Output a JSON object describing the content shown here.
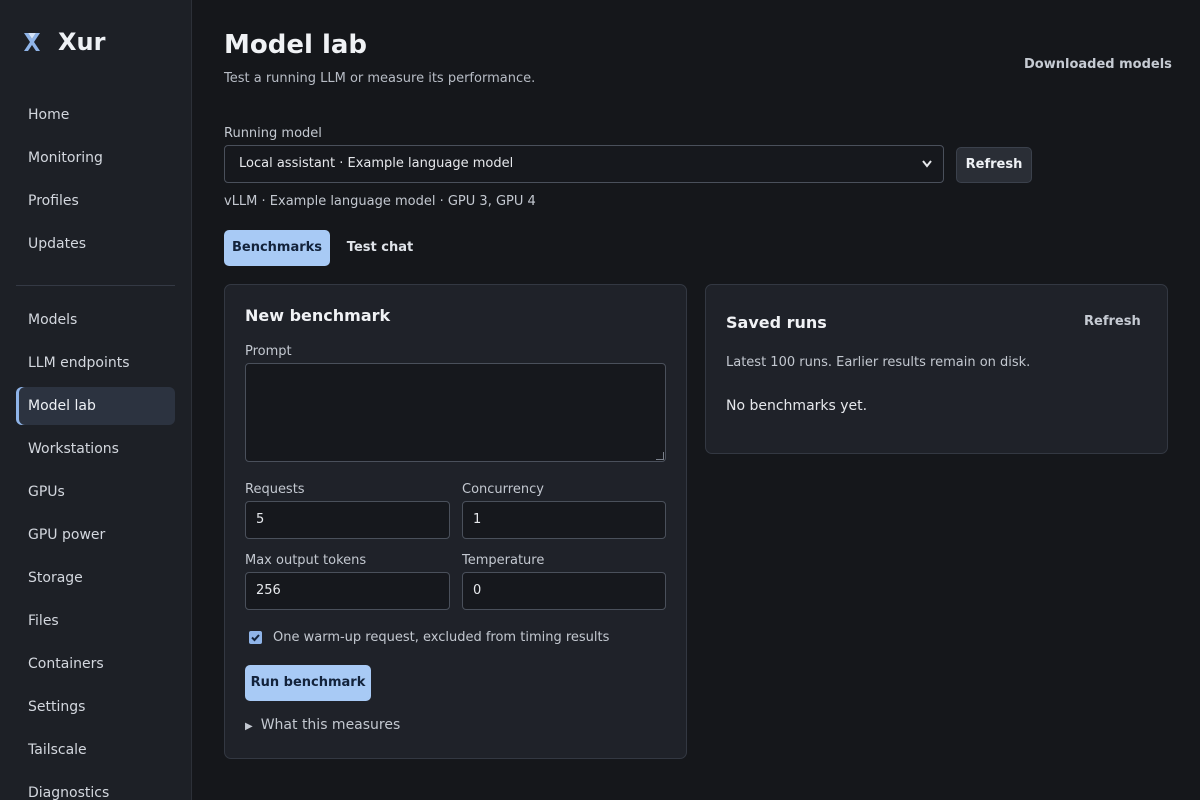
{
  "app": {
    "name": "Xur",
    "logo_icon": "x-logo-icon"
  },
  "sidebar": {
    "items_top": [
      {
        "label": "Home"
      },
      {
        "label": "Monitoring"
      },
      {
        "label": "Profiles"
      },
      {
        "label": "Updates"
      }
    ],
    "items_bottom": [
      {
        "label": "Models"
      },
      {
        "label": "LLM endpoints"
      },
      {
        "label": "Model lab",
        "active": true
      },
      {
        "label": "Workstations"
      },
      {
        "label": "GPUs"
      },
      {
        "label": "GPU power"
      },
      {
        "label": "Storage"
      },
      {
        "label": "Files"
      },
      {
        "label": "Containers"
      },
      {
        "label": "Settings"
      },
      {
        "label": "Tailscale"
      },
      {
        "label": "Diagnostics"
      }
    ]
  },
  "header": {
    "title": "Model lab",
    "subtitle": "Test a running LLM or measure its performance.",
    "downloaded_models_link": "Downloaded models"
  },
  "running_model": {
    "label": "Running model",
    "selected": "Local assistant · Example language model",
    "refresh_label": "Refresh",
    "meta": "vLLM · Example language model · GPU 3, GPU 4"
  },
  "tabs": [
    {
      "label": "Benchmarks",
      "active": true
    },
    {
      "label": "Test chat",
      "active": false
    }
  ],
  "new_benchmark": {
    "title": "New benchmark",
    "prompt_label": "Prompt",
    "prompt_value": "",
    "requests_label": "Requests",
    "requests_value": "5",
    "concurrency_label": "Concurrency",
    "concurrency_value": "1",
    "max_tokens_label": "Max output tokens",
    "max_tokens_value": "256",
    "temperature_label": "Temperature",
    "temperature_value": "0",
    "warmup_checked": true,
    "warmup_label": "One warm-up request, excluded from timing results",
    "run_label": "Run benchmark",
    "details_label": "What this measures"
  },
  "saved_runs": {
    "title": "Saved runs",
    "refresh_label": "Refresh",
    "note": "Latest 100 runs. Earlier results remain on disk.",
    "empty_text": "No benchmarks yet."
  },
  "colors": {
    "accent": "#a8caf5",
    "background": "#15171b",
    "sidebar": "#1d2026",
    "card": "#1f2229"
  }
}
